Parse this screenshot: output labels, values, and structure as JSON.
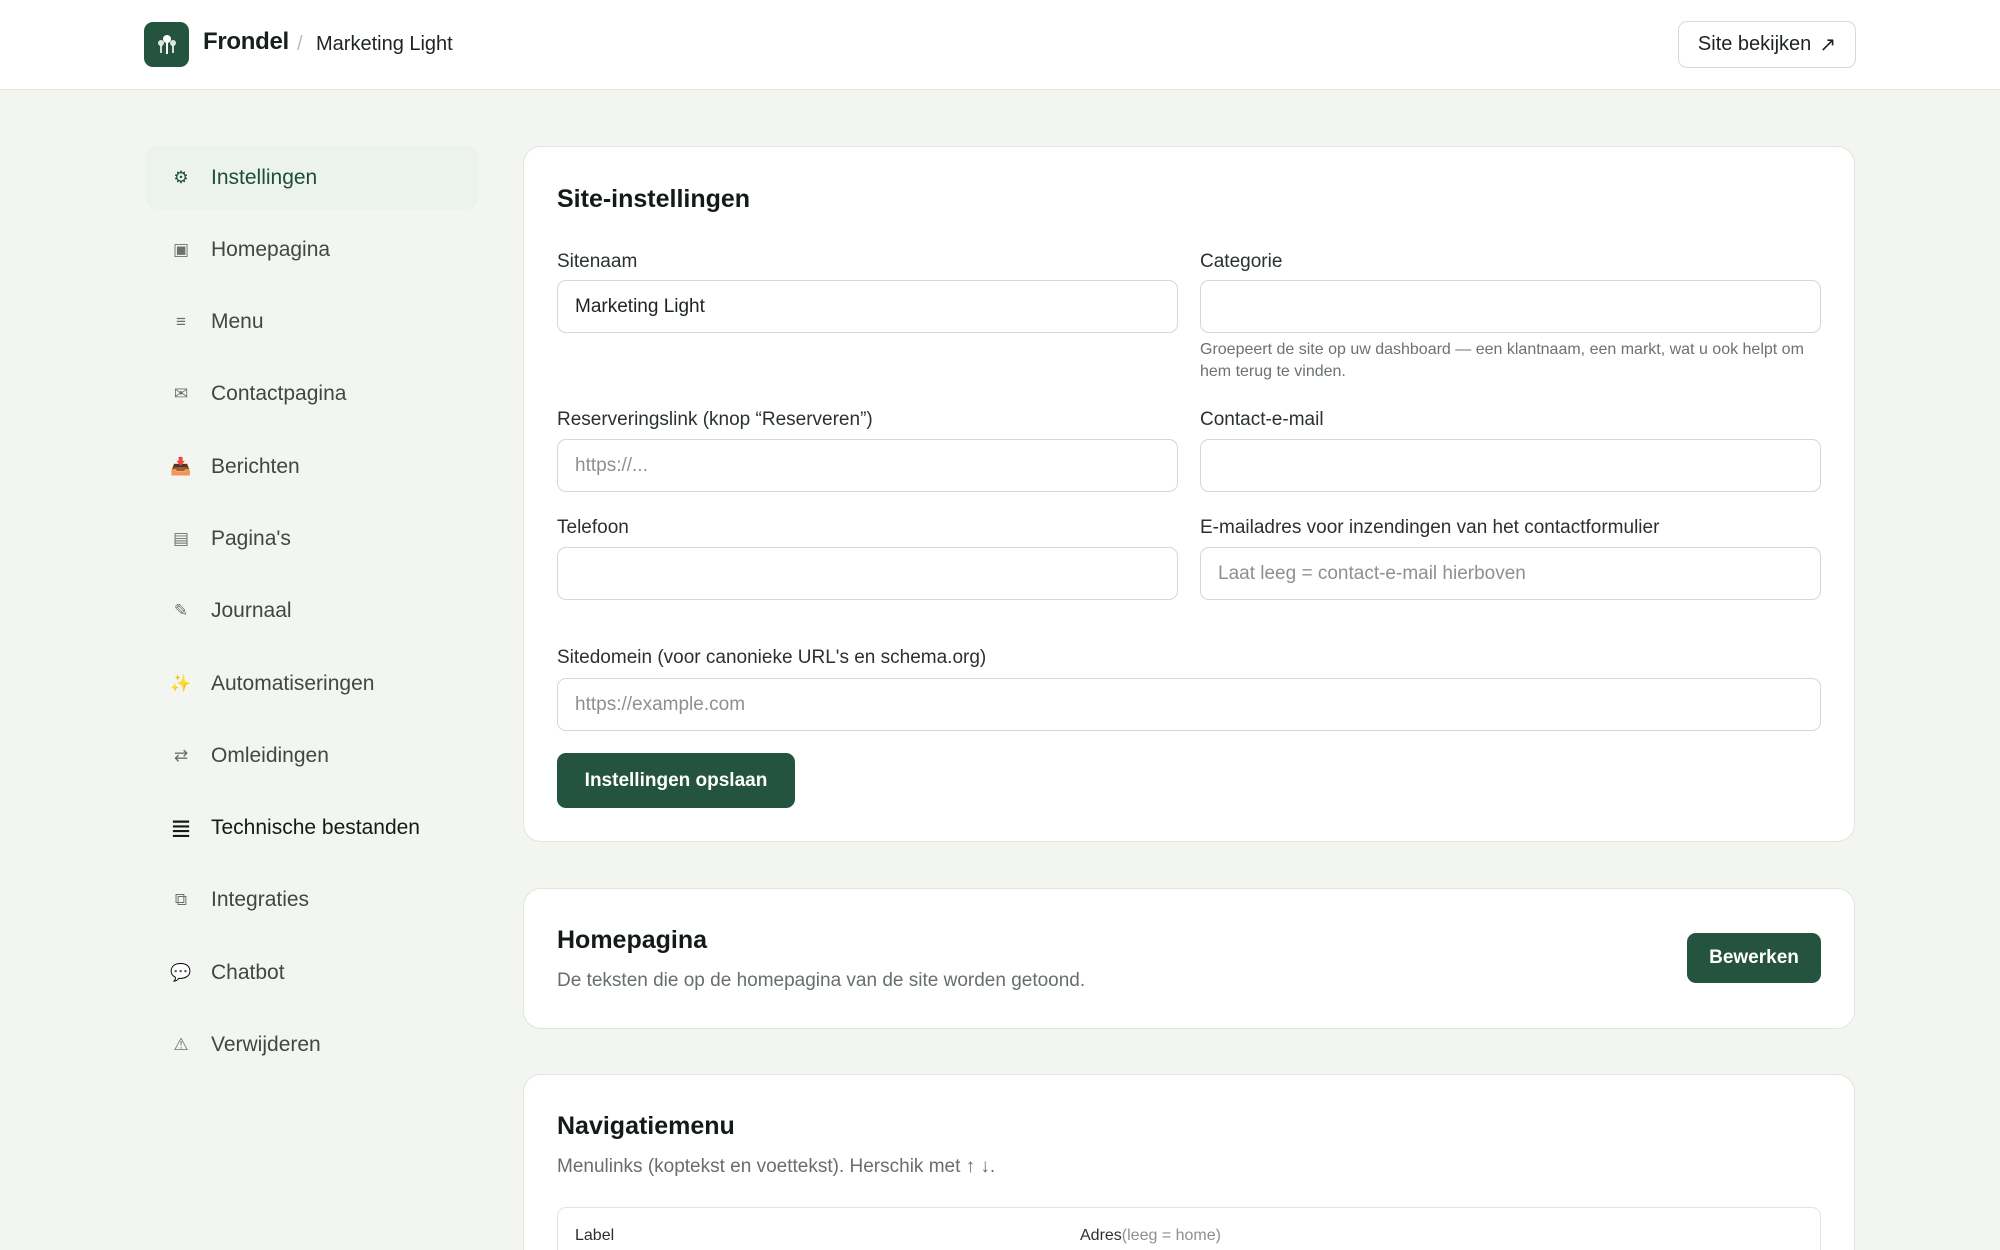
{
  "header": {
    "brand": "Frondel",
    "separator": "/",
    "site_name": "Marketing Light",
    "view_site_label": "Site bekijken",
    "view_site_icon": "↗"
  },
  "sidebar": {
    "items": [
      {
        "label": "Instellingen",
        "icon": "⚙"
      },
      {
        "label": "Homepagina",
        "icon": "▣"
      },
      {
        "label": "Menu",
        "icon": "≡"
      },
      {
        "label": "Contactpagina",
        "icon": "✉"
      },
      {
        "label": "Berichten",
        "icon": "📥"
      },
      {
        "label": "Pagina's",
        "icon": "▤"
      },
      {
        "label": "Journaal",
        "icon": "✎"
      },
      {
        "label": "Automatiseringen",
        "icon": "✨"
      },
      {
        "label": "Omleidingen",
        "icon": "⇄"
      },
      {
        "label": "Technische bestanden",
        "icon": "≣"
      },
      {
        "label": "Integraties",
        "icon": "⧉"
      },
      {
        "label": "Chatbot",
        "icon": "💬"
      },
      {
        "label": "Verwijderen",
        "icon": "⚠"
      }
    ]
  },
  "settings": {
    "title": "Site-instellingen",
    "site_name_label": "Sitenaam",
    "site_name_value": "Marketing Light",
    "category_label": "Categorie",
    "category_value": "",
    "category_help": "Groepeert de site op uw dashboard — een klantnaam, een markt, wat u ook helpt om hem terug te vinden.",
    "reservation_label": "Reserveringslink (knop “Reserveren”)",
    "reservation_placeholder": "https://...",
    "contact_email_label": "Contact-e-mail",
    "contact_email_value": "",
    "phone_label": "Telefoon",
    "phone_value": "",
    "form_email_label": "E-mailadres voor inzendingen van het contactformulier",
    "form_email_placeholder": "Laat leeg = contact-e-mail hierboven",
    "domain_label": "Sitedomein (voor canonieke URL's en schema.org)",
    "domain_placeholder": "https://example.com",
    "save_label": "Instellingen opslaan"
  },
  "homepage": {
    "title": "Homepagina",
    "subtitle": "De teksten die op de homepagina van de site worden getoond.",
    "edit_label": "Bewerken"
  },
  "navmenu": {
    "title": "Navigatiemenu",
    "subtitle": "Menulinks (koptekst en voettekst). Herschik met ↑ ↓.",
    "col_label": "Label",
    "col_address": "Adres",
    "col_address_hint": "(leeg = home)"
  },
  "colors": {
    "accent": "#24533f",
    "background": "#f3f5f1",
    "active_bg": "#ecf3ed"
  }
}
